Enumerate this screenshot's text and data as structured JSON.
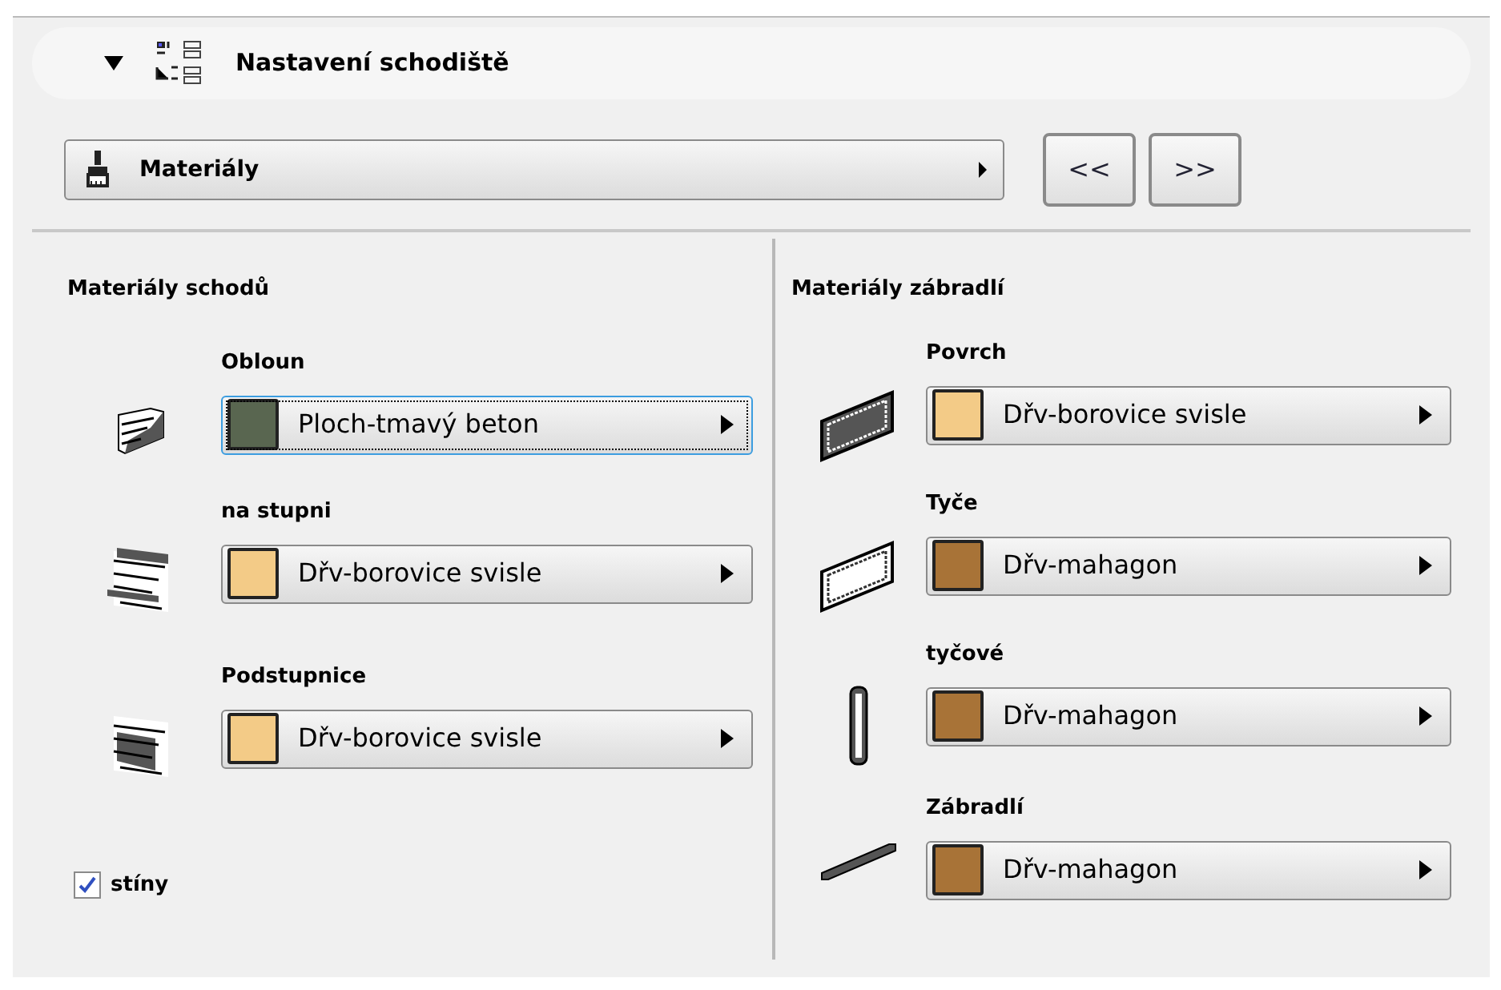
{
  "header": {
    "title": "Nastavení schodiště",
    "expanded": true
  },
  "page_selector": {
    "value": "Materiály"
  },
  "nav_buttons": [
    "<<",
    ">>"
  ],
  "stair_materials": {
    "title": "Materiály schodů",
    "items": [
      {
        "kind": "stair-nosing",
        "label": "Obloun",
        "value": "Ploch-tmavý beton",
        "color": "#596650",
        "focused": true
      },
      {
        "kind": "stair-tread",
        "label": "na stupni",
        "value": "Dřv-borovice svisle",
        "color": "#f3cb87",
        "focused": false
      },
      {
        "kind": "stair-riser",
        "label": "Podstupnice",
        "value": "Dřv-borovice svisle",
        "color": "#f3cb87",
        "focused": false
      }
    ],
    "shadows": {
      "label": "stíny",
      "checked": true
    }
  },
  "railing_materials": {
    "title": "Materiály zábradlí",
    "items": [
      {
        "kind": "panel-solid",
        "label": "Povrch",
        "value": "Dřv-borovice svisle",
        "color": "#f3cb87",
        "focused": false
      },
      {
        "kind": "panel-frame",
        "label": "Tyče",
        "value": "Dřv-mahagon",
        "color": "#a87337",
        "focused": false
      },
      {
        "kind": "baluster",
        "label": "tyčové",
        "value": "Dřv-mahagon",
        "color": "#a87337",
        "focused": false
      },
      {
        "kind": "handrail",
        "label": "Zábradlí",
        "value": "Dřv-mahagon",
        "color": "#a87337",
        "focused": false
      }
    ]
  }
}
